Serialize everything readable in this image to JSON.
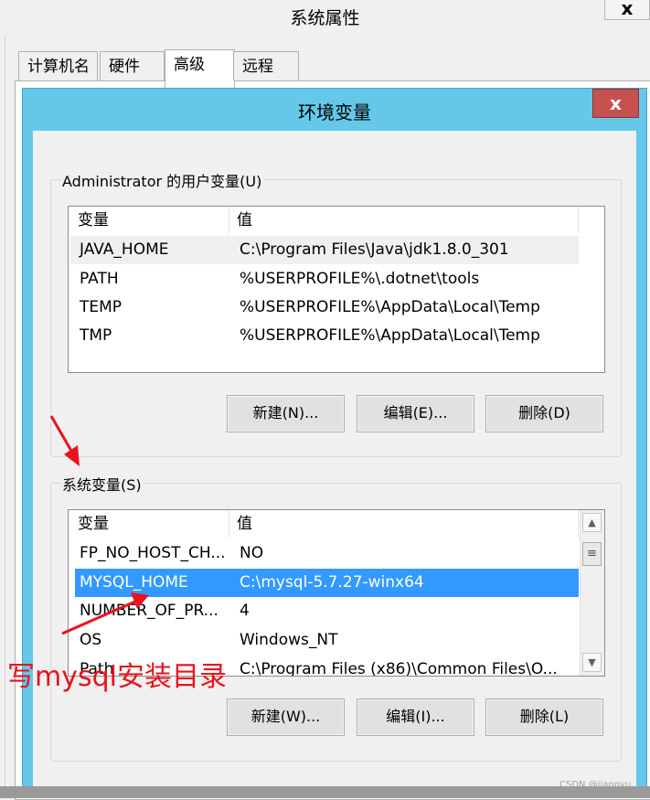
{
  "back_window": {
    "title": "系统属性",
    "close_glyph": "x",
    "tabs": [
      {
        "label": "计算机名"
      },
      {
        "label": "硬件"
      },
      {
        "label": "高级"
      },
      {
        "label": "远程"
      }
    ]
  },
  "env_dialog": {
    "title": "环境变量",
    "close_glyph": "x",
    "user_vars": {
      "group_label": "Administrator 的用户变量(U)",
      "columns": [
        "变量",
        "值"
      ],
      "rows": [
        {
          "name": "JAVA_HOME",
          "value": "C:\\Program Files\\Java\\jdk1.8.0_301"
        },
        {
          "name": "PATH",
          "value": "%USERPROFILE%\\.dotnet\\tools"
        },
        {
          "name": "TEMP",
          "value": "%USERPROFILE%\\AppData\\Local\\Temp"
        },
        {
          "name": "TMP",
          "value": "%USERPROFILE%\\AppData\\Local\\Temp"
        }
      ],
      "buttons": {
        "new": "新建(N)...",
        "edit": "编辑(E)...",
        "delete": "删除(D)"
      }
    },
    "system_vars": {
      "group_label": "系统变量(S)",
      "columns": [
        "变量",
        "值"
      ],
      "rows": [
        {
          "name": "FP_NO_HOST_CH...",
          "value": "NO"
        },
        {
          "name": "MYSQL_HOME",
          "value": "C:\\mysql-5.7.27-winx64"
        },
        {
          "name": "NUMBER_OF_PR...",
          "value": "4"
        },
        {
          "name": "OS",
          "value": "Windows_NT"
        },
        {
          "name": "Path",
          "value": "C:\\Program Files (x86)\\Common Files\\O..."
        }
      ],
      "selected_row": "MYSQL_HOME",
      "buttons": {
        "new": "新建(W)...",
        "edit": "编辑(I)...",
        "delete": "删除(L)"
      }
    }
  },
  "annotation": {
    "text": "写mysql安装目录",
    "color": "#e8131c"
  },
  "watermark": "CSDN @jiangyu",
  "colors": {
    "dialog_frame": "#65c8e8",
    "close_button": "#c75050",
    "selection": "#3399ff"
  },
  "icons": [
    "close-icon",
    "scroll-up-icon",
    "scroll-down-icon",
    "scroll-thumb-icon",
    "annotation-arrow-icon"
  ]
}
